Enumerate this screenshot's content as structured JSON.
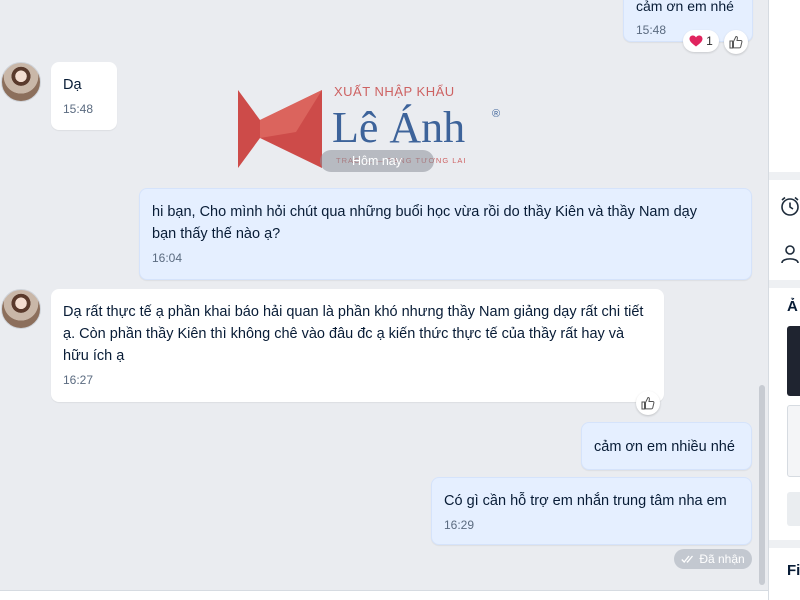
{
  "conversation": {
    "date_separator": "Hôm nay",
    "messages": [
      {
        "id": "m0",
        "direction": "out",
        "text": "cảm ơn em nhé",
        "time": "15:48"
      },
      {
        "id": "m1",
        "direction": "in",
        "text": "Dạ",
        "time": "15:48"
      },
      {
        "id": "m2",
        "direction": "out",
        "text": "hi bạn, Cho mình hỏi chút qua những buổi học vừa rồi do thầy Kiên và thầy Nam dạy bạn thấy thế nào ạ?",
        "time": "16:04"
      },
      {
        "id": "m3",
        "direction": "in",
        "text": "Dạ rất thực tế ạ phần khai báo hải quan là phần khó nhưng thầy Nam giảng dạy rất chi tiết ạ. Còn phần thầy Kiên thì không chê vào đâu đc ạ kiến thức thực tế của thầy rất hay và hữu ích ạ",
        "time": "16:27"
      },
      {
        "id": "m4",
        "direction": "out",
        "text": "cảm ơn em nhiều nhé",
        "time": ""
      },
      {
        "id": "m5",
        "direction": "out",
        "text": "Có gì cần hỗ trợ em nhắn trung tâm nha em",
        "time": "16:29"
      }
    ],
    "reaction": {
      "icon": "heart-icon",
      "count": "1",
      "color": "#e0245e"
    },
    "status": "Đã nhận"
  },
  "watermark": {
    "top": "XUẤT NHẬP KHẨU",
    "main": "Lê Ánh",
    "reg": "®",
    "tag": "TRAO ... — TẠNG TƯƠNG LAI"
  },
  "right_panel": {
    "section_a": "Ả",
    "section_fi": "Fil",
    "icons": [
      "alarm-clock-icon",
      "user-icon"
    ]
  },
  "colors": {
    "accent": "#0068ff",
    "out_bubble": "#e5efff",
    "in_bubble": "#ffffff",
    "chat_bg": "#eaecf0"
  }
}
